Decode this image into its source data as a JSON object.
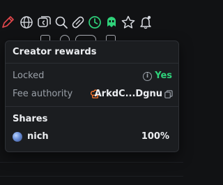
{
  "toolbar": {
    "icons": [
      "pen-icon",
      "globe-icon",
      "copy-symbol-icon",
      "search-icon",
      "link-icon",
      "clock-icon",
      "bug-icon",
      "star-icon",
      "bell-icon"
    ],
    "accent_color": "#2fd17a",
    "danger_color": "#e5484d"
  },
  "popup": {
    "title": "Creator rewards",
    "locked": {
      "label": "Locked",
      "value": "Yes",
      "value_color": "#2fd17a"
    },
    "fee_authority": {
      "label": "Fee authority",
      "value": "ArkdC...Dgnu",
      "icon": "chef-hat-icon",
      "icon_color": "#ff7a2f"
    },
    "shares": {
      "title": "Shares",
      "holders": [
        {
          "name": "nich",
          "percent": "100%"
        }
      ]
    }
  }
}
